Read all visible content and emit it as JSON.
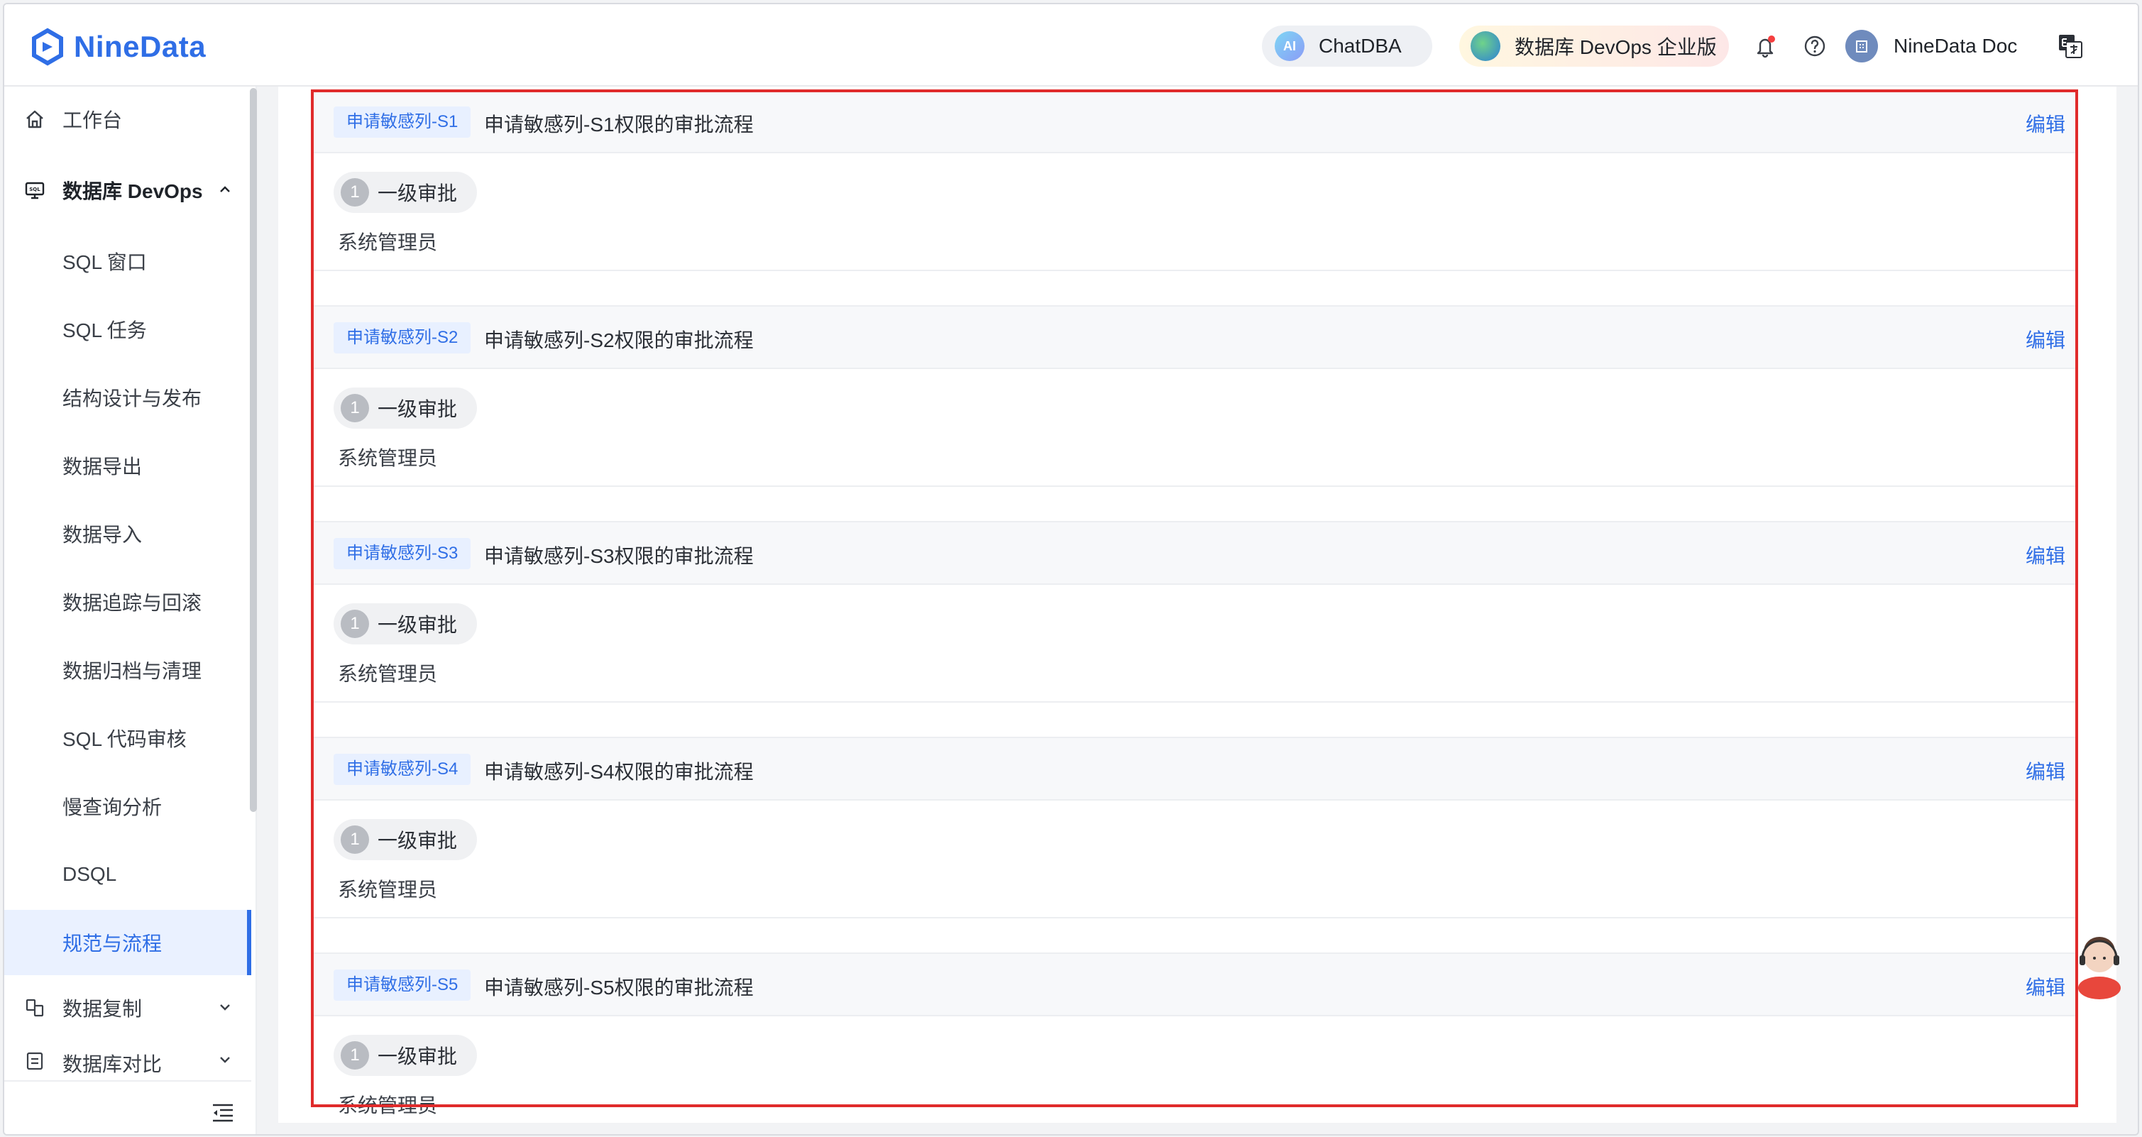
{
  "header": {
    "logo_text": "NineData",
    "chatdba_label": "ChatDBA",
    "ai_badge": "AI",
    "devops_label": "数据库 DevOps 企业版",
    "user_name": "NineData Doc"
  },
  "sidebar": {
    "workbench": "工作台",
    "devops_group": "数据库 DevOps",
    "items": [
      {
        "label": "SQL 窗口"
      },
      {
        "label": "SQL 任务"
      },
      {
        "label": "结构设计与发布"
      },
      {
        "label": "数据导出"
      },
      {
        "label": "数据导入"
      },
      {
        "label": "数据追踪与回滚"
      },
      {
        "label": "数据归档与清理"
      },
      {
        "label": "SQL 代码审核"
      },
      {
        "label": "慢查询分析"
      },
      {
        "label": "DSQL"
      },
      {
        "label": "规范与流程",
        "active": true
      }
    ],
    "replication_group": "数据复制",
    "compare_group": "数据库对比"
  },
  "cards": [
    {
      "tag": "申请敏感列-S1",
      "title": "申请敏感列-S1权限的审批流程",
      "edit": "编辑",
      "step_num": "1",
      "step_label": "一级审批",
      "approver": "系统管理员"
    },
    {
      "tag": "申请敏感列-S2",
      "title": "申请敏感列-S2权限的审批流程",
      "edit": "编辑",
      "step_num": "1",
      "step_label": "一级审批",
      "approver": "系统管理员"
    },
    {
      "tag": "申请敏感列-S3",
      "title": "申请敏感列-S3权限的审批流程",
      "edit": "编辑",
      "step_num": "1",
      "step_label": "一级审批",
      "approver": "系统管理员"
    },
    {
      "tag": "申请敏感列-S4",
      "title": "申请敏感列-S4权限的审批流程",
      "edit": "编辑",
      "step_num": "1",
      "step_label": "一级审批",
      "approver": "系统管理员"
    },
    {
      "tag": "申请敏感列-S5",
      "title": "申请敏感列-S5权限的审批流程",
      "edit": "编辑",
      "step_num": "1",
      "step_label": "一级审批",
      "approver": "系统管理员"
    }
  ],
  "colors": {
    "accent": "#2f6ee6",
    "highlight": "#e02b2b"
  }
}
